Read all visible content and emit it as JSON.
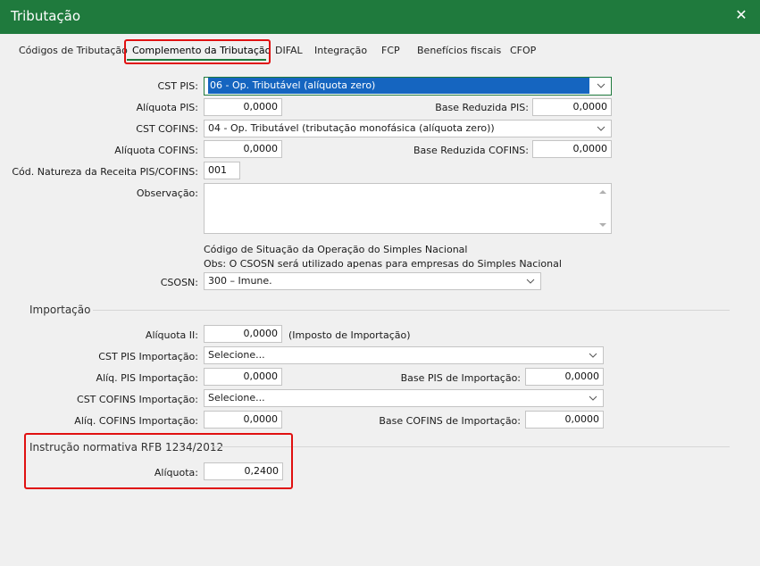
{
  "window": {
    "title": "Tributação",
    "close_glyph": "✕"
  },
  "tabs": [
    {
      "label": "Códigos de Tributação"
    },
    {
      "label": "Complemento da Tributação"
    },
    {
      "label": "DIFAL"
    },
    {
      "label": "Integração"
    },
    {
      "label": "FCP"
    },
    {
      "label": "Benefícios fiscais"
    },
    {
      "label": "CFOP"
    }
  ],
  "active_tab": "Complemento da Tributação",
  "colors": {
    "titlebar": "#1f7a3d",
    "highlight": "#e01010",
    "selection": "#1565c0"
  },
  "form": {
    "cst_pis": {
      "label": "CST PIS:",
      "value": "06 - Op. Tributável (alíquota zero)"
    },
    "aliquota_pis": {
      "label": "Alíquota PIS:",
      "value": "0,0000"
    },
    "base_reduzida_pis": {
      "label": "Base Reduzida PIS:",
      "value": "0,0000"
    },
    "cst_cofins": {
      "label": "CST COFINS:",
      "value": "04 - Op. Tributável (tributação monofásica (alíquota zero))"
    },
    "aliquota_cofins": {
      "label": "Alíquota COFINS:",
      "value": "0,0000"
    },
    "base_reduzida_cofins": {
      "label": "Base Reduzida COFINS:",
      "value": "0,0000"
    },
    "natureza_receita": {
      "label": "Cód. Natureza da Receita PIS/COFINS:",
      "value": "001"
    },
    "observacao": {
      "label": "Observação:",
      "value": ""
    },
    "simples_heading": "Código de Situação da Operação do Simples Nacional",
    "simples_note": "Obs: O CSOSN será utilizado apenas para empresas do Simples Nacional",
    "csosn": {
      "label": "CSOSN:",
      "value": "300 – Imune."
    }
  },
  "importacao": {
    "title": "Importação",
    "aliquota_ii": {
      "label": "Alíquota II:",
      "value": "0,0000",
      "suffix": "(Imposto de Importação)"
    },
    "cst_pis_imp": {
      "label": "CST PIS Importação:",
      "value": "Selecione..."
    },
    "aliq_pis_imp": {
      "label": "Alíq. PIS Importação:",
      "value": "0,0000"
    },
    "base_pis_imp": {
      "label": "Base PIS de Importação:",
      "value": "0,0000"
    },
    "cst_cofins_imp": {
      "label": "CST COFINS Importação:",
      "value": "Selecione..."
    },
    "aliq_cofins_imp": {
      "label": "Alíq. COFINS Importação:",
      "value": "0,0000"
    },
    "base_cofins_imp": {
      "label": "Base COFINS de Importação:",
      "value": "0,0000"
    }
  },
  "instrucao": {
    "title": "Instrução normativa RFB 1234/2012",
    "aliquota": {
      "label": "Alíquota:",
      "value": "0,2400"
    }
  },
  "icons": {
    "close": "close-icon",
    "dropdown": "chevron-down-icon",
    "scroll_up": "scroll-up-icon",
    "scroll_down": "scroll-down-icon"
  }
}
